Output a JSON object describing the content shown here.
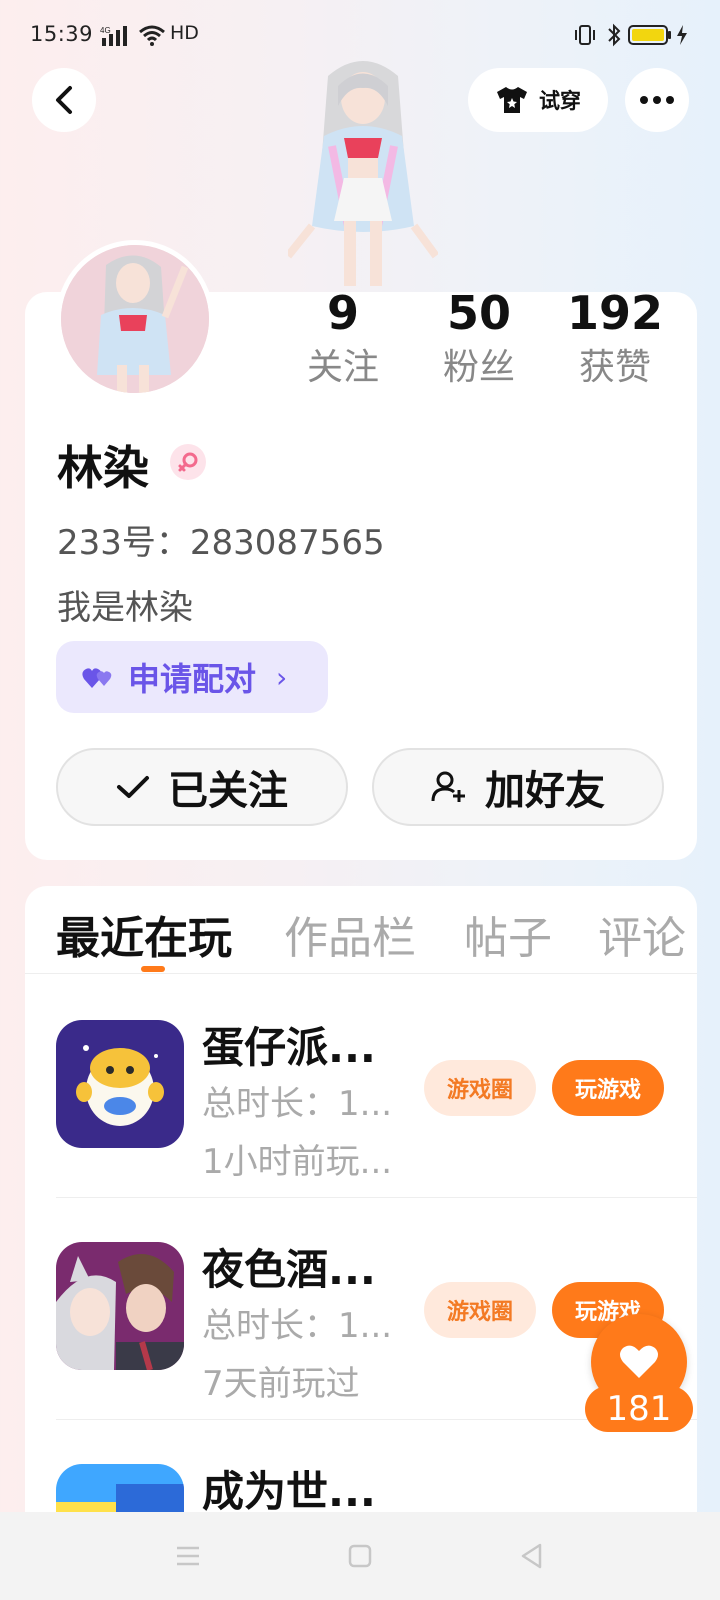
{
  "status_bar": {
    "time": "15:39",
    "network": "4G",
    "hd": "HD",
    "icons": [
      "signal-icon",
      "wifi-icon",
      "vibrate-icon",
      "bluetooth-icon",
      "battery-icon",
      "charging-icon"
    ]
  },
  "header": {
    "try_on_label": "试穿",
    "icons": [
      "back-icon",
      "tshirt-icon",
      "more-icon"
    ]
  },
  "profile": {
    "stats": [
      {
        "value": "9",
        "label": "关注"
      },
      {
        "value": "50",
        "label": "粉丝"
      },
      {
        "value": "192",
        "label": "获赞"
      }
    ],
    "name": "林染",
    "gender_icon": "female-icon",
    "uid": "233号：283087565",
    "bio": "我是林染",
    "pair_label": "申请配对",
    "follow_label": "已关注",
    "add_friend_label": "加好友"
  },
  "tabs": [
    {
      "label": "最近在玩",
      "active": true
    },
    {
      "label": "作品栏",
      "active": false
    },
    {
      "label": "帖子",
      "active": false
    },
    {
      "label": "评论",
      "active": false
    }
  ],
  "games": [
    {
      "name": "蛋仔派...",
      "total_time": "总时长：1...",
      "last_played": "1小时前玩...",
      "circle_label": "游戏圈",
      "play_label": "玩游戏"
    },
    {
      "name": "夜色酒...",
      "total_time": "总时长：1...",
      "last_played": "7天前玩过",
      "circle_label": "游戏圈",
      "play_label": "玩游戏"
    },
    {
      "name": "成为世...",
      "total_time": "",
      "last_played": "",
      "circle_label": "",
      "play_label": ""
    }
  ],
  "like": {
    "count": "181",
    "icon": "heart-icon"
  },
  "colors": {
    "accent": "#ff7a1a",
    "pair": "#6a55e8",
    "pair_bg": "#ebe8fd"
  }
}
